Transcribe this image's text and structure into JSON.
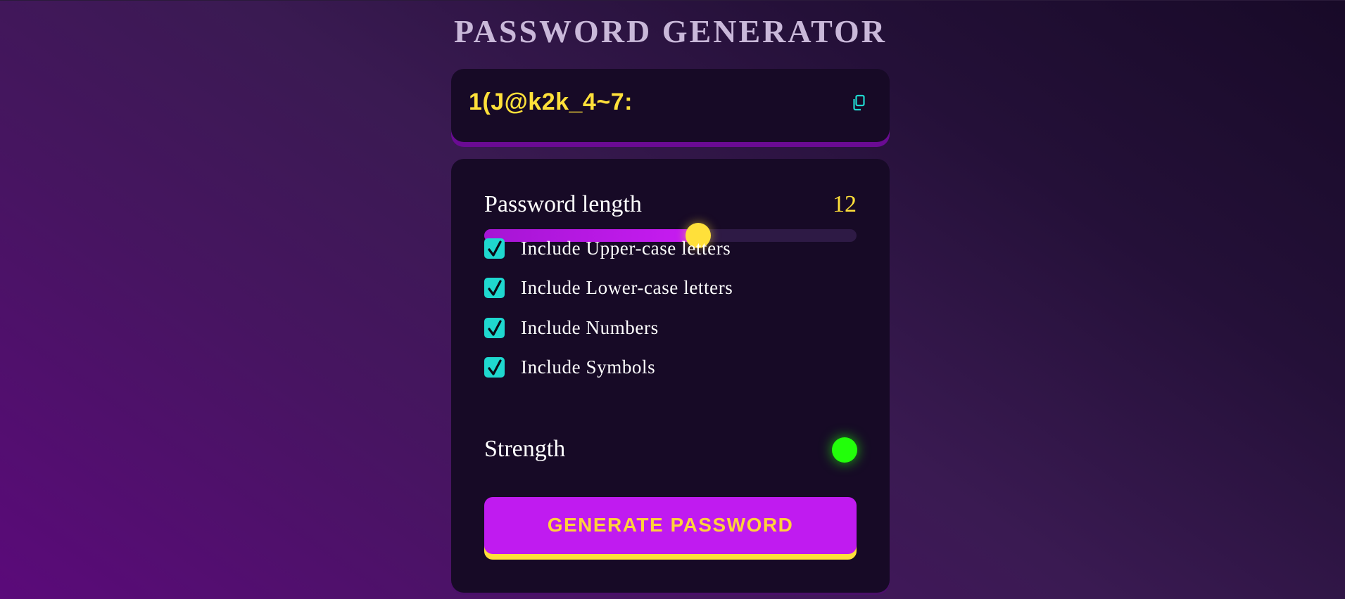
{
  "header": {
    "title": "PASSWORD GENERATOR"
  },
  "output": {
    "password": "1(J@k2k_4~7:",
    "copy_icon": "copy-icon"
  },
  "length": {
    "label": "Password length",
    "value": "12",
    "fraction": 0.575
  },
  "options": [
    {
      "label": "Include Upper-case letters",
      "checked": true
    },
    {
      "label": "Include Lower-case letters",
      "checked": true
    },
    {
      "label": "Include Numbers",
      "checked": true
    },
    {
      "label": "Include Symbols",
      "checked": true
    }
  ],
  "strength": {
    "label": "Strength",
    "color": "#22ff0a"
  },
  "generate": {
    "label": "GENERATE PASSWORD"
  },
  "colors": {
    "accent_yellow": "#ffe03a",
    "accent_purple": "#c01bf0",
    "checkbox_teal": "#1fd8cf",
    "panel_bg": "#170a26"
  }
}
